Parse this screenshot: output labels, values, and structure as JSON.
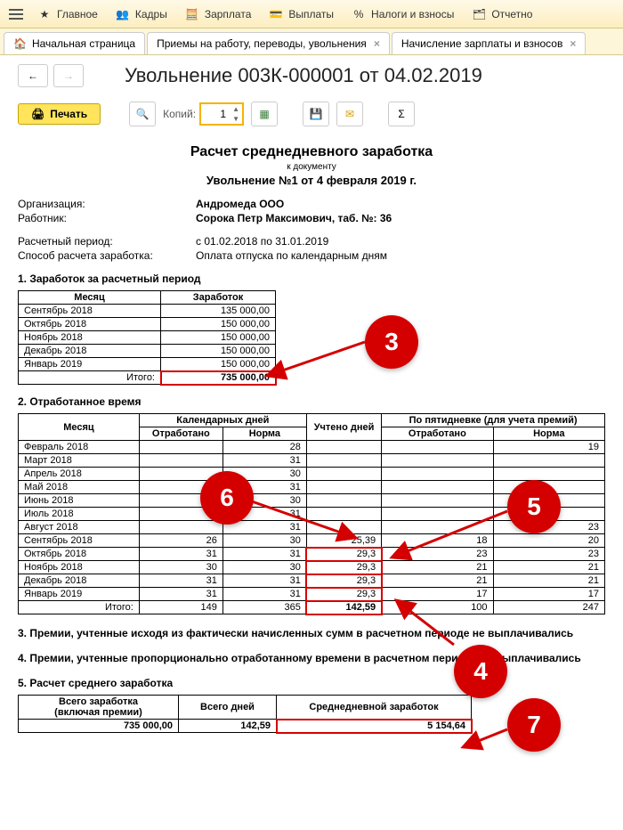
{
  "topmenu": {
    "items": [
      "Главное",
      "Кадры",
      "Зарплата",
      "Выплаты",
      "Налоги и взносы",
      "Отчетно"
    ]
  },
  "tabs": {
    "home": "Начальная страница",
    "tab1": "Приемы на работу, переводы, увольнения",
    "tab2": "Начисление зарплаты и взносов"
  },
  "page_title": "Увольнение 003К-000001 от 04.02.2019",
  "toolbar": {
    "print": "Печать",
    "copies_label": "Копий:",
    "copies_value": "1"
  },
  "doc": {
    "title": "Расчет среднедневного заработка",
    "sub": "к документу",
    "subtitle": "Увольнение №1 от 4 февраля 2019 г.",
    "org_label": "Организация:",
    "org_value": "Андромеда ООО",
    "emp_label": "Работник:",
    "emp_value": "Сорока Петр Максимович, таб. №: 36",
    "period_label": "Расчетный период:",
    "period_value": "с 01.02.2018 по 31.01.2019",
    "method_label": "Способ расчета заработка:",
    "method_value": "Оплата отпуска по календарным дням"
  },
  "section1": {
    "title": "1. Заработок за расчетный период",
    "h_month": "Месяц",
    "h_earn": "Заработок",
    "rows": [
      {
        "m": "Сентябрь 2018",
        "v": "135 000,00"
      },
      {
        "m": "Октябрь 2018",
        "v": "150 000,00"
      },
      {
        "m": "Ноябрь 2018",
        "v": "150 000,00"
      },
      {
        "m": "Декабрь 2018",
        "v": "150 000,00"
      },
      {
        "m": "Январь 2019",
        "v": "150 000,00"
      }
    ],
    "total_label": "Итого:",
    "total_value": "735 000,00"
  },
  "section2": {
    "title": "2. Отработанное время",
    "h_month": "Месяц",
    "h_cal": "Календарных дней",
    "h_uch": "Учтено дней",
    "h_week": "По пятидневке (для учета премий)",
    "h_worked": "Отработано",
    "h_norm": "Норма",
    "rows": [
      {
        "m": "Февраль 2018",
        "cw": "",
        "cn": "28",
        "u": "",
        "ww": "",
        "wn": "19"
      },
      {
        "m": "Март 2018",
        "cw": "",
        "cn": "31",
        "u": "",
        "ww": "",
        "wn": ""
      },
      {
        "m": "Апрель 2018",
        "cw": "",
        "cn": "30",
        "u": "",
        "ww": "",
        "wn": ""
      },
      {
        "m": "Май 2018",
        "cw": "",
        "cn": "31",
        "u": "",
        "ww": "",
        "wn": ""
      },
      {
        "m": "Июнь 2018",
        "cw": "",
        "cn": "30",
        "u": "",
        "ww": "",
        "wn": ""
      },
      {
        "m": "Июль 2018",
        "cw": "",
        "cn": "31",
        "u": "",
        "ww": "",
        "wn": ""
      },
      {
        "m": "Август 2018",
        "cw": "",
        "cn": "31",
        "u": "",
        "ww": "",
        "wn": "23"
      },
      {
        "m": "Сентябрь 2018",
        "cw": "26",
        "cn": "30",
        "u": "25,39",
        "ww": "18",
        "wn": "20"
      },
      {
        "m": "Октябрь 2018",
        "cw": "31",
        "cn": "31",
        "u": "29,3",
        "ww": "23",
        "wn": "23"
      },
      {
        "m": "Ноябрь 2018",
        "cw": "30",
        "cn": "30",
        "u": "29,3",
        "ww": "21",
        "wn": "21"
      },
      {
        "m": "Декабрь 2018",
        "cw": "31",
        "cn": "31",
        "u": "29,3",
        "ww": "21",
        "wn": "21"
      },
      {
        "m": "Январь 2019",
        "cw": "31",
        "cn": "31",
        "u": "29,3",
        "ww": "17",
        "wn": "17"
      }
    ],
    "total_label": "Итого:",
    "totals": {
      "cw": "149",
      "cn": "365",
      "u": "142,59",
      "ww": "100",
      "wn": "247"
    }
  },
  "section3": "3. Премии, учтенные исходя из фактически начисленных сумм в расчетном периоде не выплачивались",
  "section4": "4. Премии, учтенные пропорционально отработанному времени в расчетном периоде не выплачивались",
  "section5": {
    "title": "5. Расчет среднего  заработка",
    "h1a": "Всего заработка",
    "h1b": "(включая премии)",
    "h2": "Всего дней",
    "h3": "Среднедневной заработок",
    "v1": "735 000,00",
    "v2": "142,59",
    "v3": "5 154,64"
  },
  "callouts": {
    "c3": "3",
    "c4": "4",
    "c5": "5",
    "c6": "6",
    "c7": "7"
  }
}
